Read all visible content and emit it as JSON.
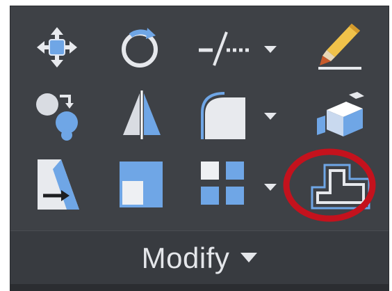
{
  "panel": {
    "title": "Modify"
  },
  "tools": [
    {
      "id": "move",
      "icon": "move-icon"
    },
    {
      "id": "rotate",
      "icon": "rotate-icon"
    },
    {
      "id": "trim",
      "icon": "trim-icon",
      "has_dropdown": true
    },
    {
      "id": "erase",
      "icon": "eraser-pencil-icon"
    },
    {
      "id": "copy",
      "icon": "copy-icon"
    },
    {
      "id": "mirror",
      "icon": "mirror-icon"
    },
    {
      "id": "fillet",
      "icon": "fillet-icon",
      "has_dropdown": true
    },
    {
      "id": "explode",
      "icon": "explode-icon"
    },
    {
      "id": "stretch",
      "icon": "stretch-icon"
    },
    {
      "id": "scale",
      "icon": "scale-icon"
    },
    {
      "id": "array",
      "icon": "array-icon",
      "has_dropdown": true
    },
    {
      "id": "offset",
      "icon": "offset-icon",
      "highlighted": true
    }
  ],
  "colors": {
    "panel_bg": "#3e4146",
    "icon_blue": "#6fa6e6",
    "icon_white": "#eef0f3",
    "highlight_red": "#c4121d",
    "label": "#e4e6ea"
  }
}
